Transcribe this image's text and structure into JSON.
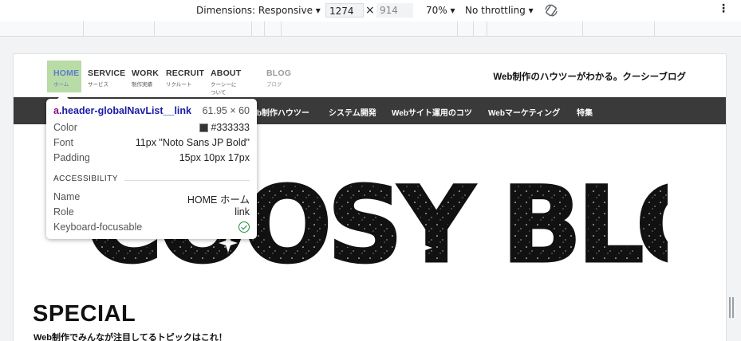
{
  "toolbar": {
    "dimensions_label": "Dimensions: Responsive",
    "width_value": "1274",
    "times": "×",
    "height_value": "914",
    "zoom": "70%",
    "throttling": "No throttling",
    "rotate_icon": "rotate-icon",
    "more_icon": "more-vert-icon",
    "dropdown_arrow": "▾"
  },
  "site": {
    "tagline": "Web制作のハウツーがわかる。クーシーブログ",
    "nav": [
      {
        "en": "HOME",
        "jp": "ホーム"
      },
      {
        "en": "SERVICE",
        "jp": "サービス"
      },
      {
        "en": "WORK",
        "jp": "制作実績"
      },
      {
        "en": "RECRUIT",
        "jp": "リクルート"
      },
      {
        "en": "ABOUT",
        "jp": "クーシーについて"
      },
      {
        "en": "BLOG",
        "jp": "ブログ"
      }
    ],
    "categories": [
      "Web制作ハウツー",
      "システム開発",
      "Webサイト運用のコツ",
      "Webマーケティング",
      "特集"
    ],
    "hero_title": "COOSY BLOG",
    "special_title": "SPECIAL",
    "special_sub": "Web制作でみんなが注目してるトピックはこれ！"
  },
  "tooltip": {
    "selector_tag": "a",
    "selector_class": ".header-globalNavList__link",
    "size": "61.95 × 60",
    "rows": [
      {
        "k": "Color",
        "v": "#333333"
      },
      {
        "k": "Font",
        "v": "11px \"Noto Sans JP Bold\""
      },
      {
        "k": "Padding",
        "v": "15px 10px 17px"
      }
    ],
    "section": "ACCESSIBILITY",
    "a11y": [
      {
        "k": "Name",
        "v": "HOME ホーム"
      },
      {
        "k": "Role",
        "v": "link"
      },
      {
        "k": "Keyboard-focusable",
        "v": ""
      }
    ]
  },
  "colors": {
    "nav_highlight": "#b9dba6",
    "category_bar": "#3a3a3a",
    "selector_tag": "#881280",
    "selector_class": "#1a1aa6",
    "check": "#1e8e3e"
  }
}
